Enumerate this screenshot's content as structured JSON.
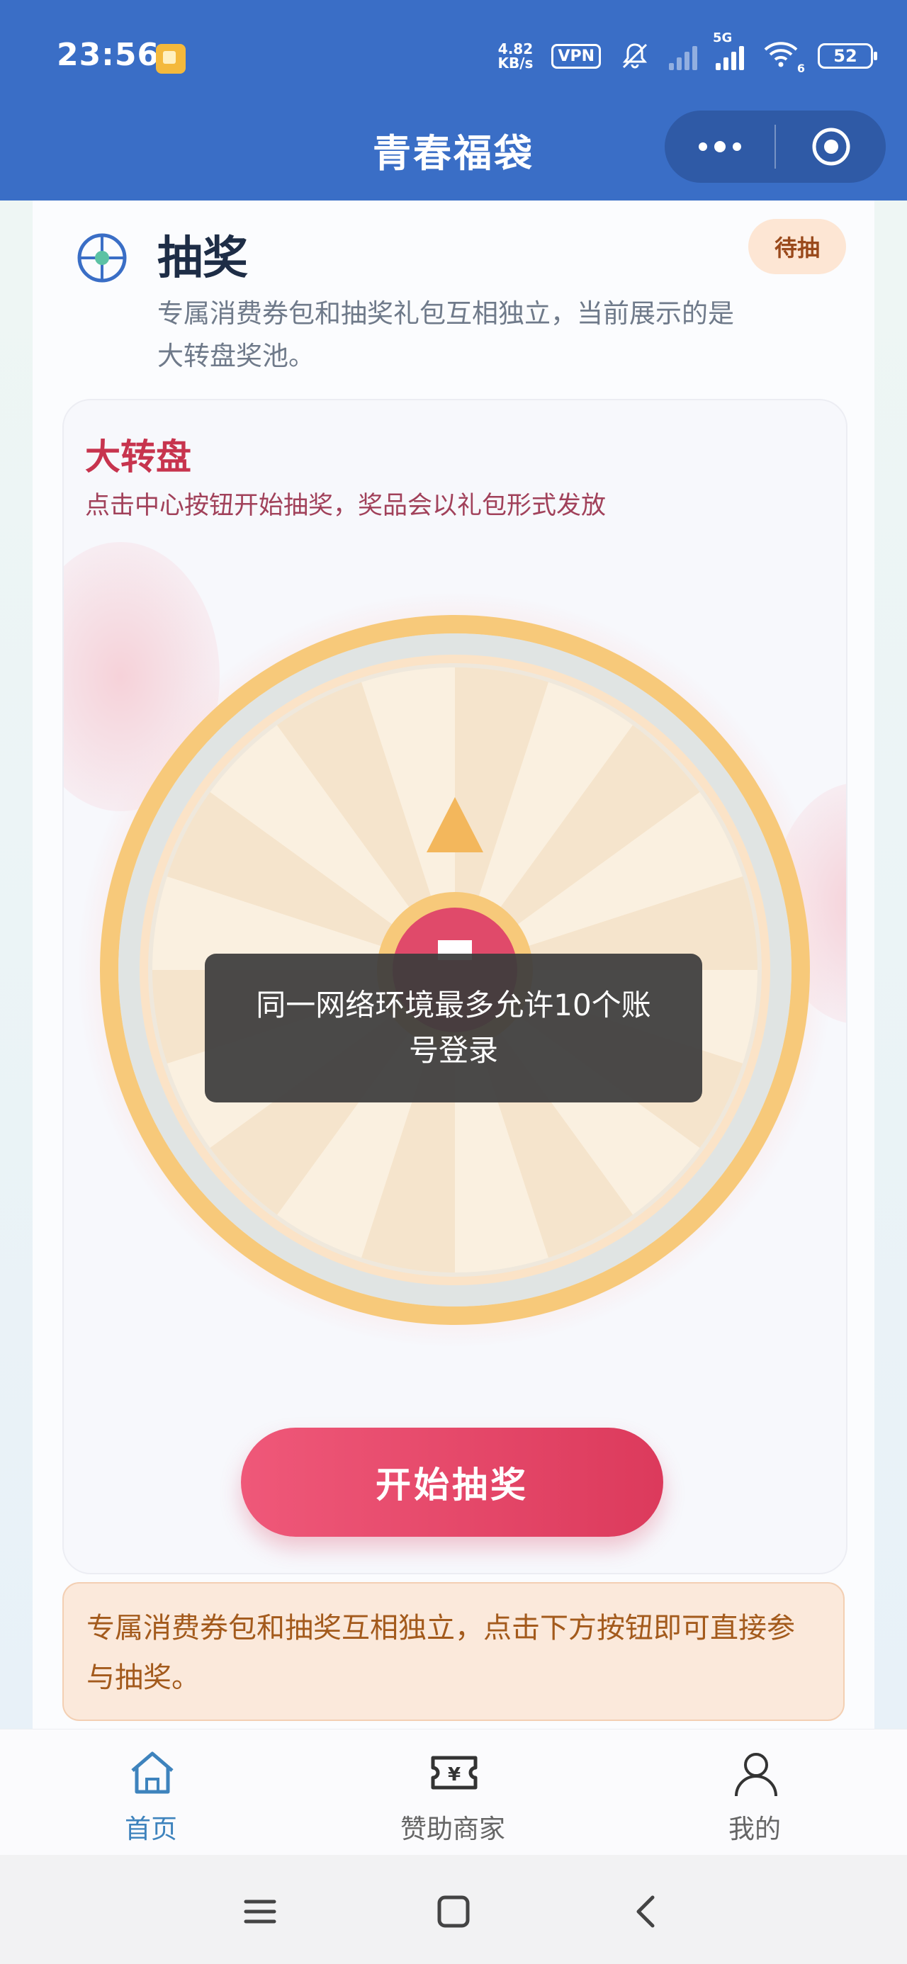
{
  "status_bar": {
    "time": "23:56",
    "net_speed_value": "4.82",
    "net_speed_unit": "KB/s",
    "vpn": "VPN",
    "network_type": "5G",
    "wifi_sub": "6",
    "battery": "52"
  },
  "header": {
    "title": "青春福袋"
  },
  "draw_section": {
    "title": "抽奖",
    "status_badge": "待抽",
    "description": "专属消费券包和抽奖礼包互相独立，当前展示的是大转盘奖池。"
  },
  "wheel_panel": {
    "title": "大转盘",
    "subtitle": "点击中心按钮开始抽奖，奖品会以礼包形式发放",
    "start_button": "开始抽奖"
  },
  "notice": {
    "text": "专属消费券包和抽奖互相独立，点击下方按钮即可直接参与抽奖。"
  },
  "toast": {
    "text": "同一网络环境最多允许10个账号登录"
  },
  "tabbar": {
    "items": [
      {
        "label": "首页",
        "icon": "home-icon",
        "active": true
      },
      {
        "label": "赞助商家",
        "icon": "ticket-icon",
        "active": false
      },
      {
        "label": "我的",
        "icon": "user-icon",
        "active": false
      }
    ]
  },
  "colors": {
    "header": "#3a6ec6",
    "accent_red": "#dc3a5c",
    "tab_active": "#3e83bd",
    "wheel_gold": "#f7c97a"
  }
}
